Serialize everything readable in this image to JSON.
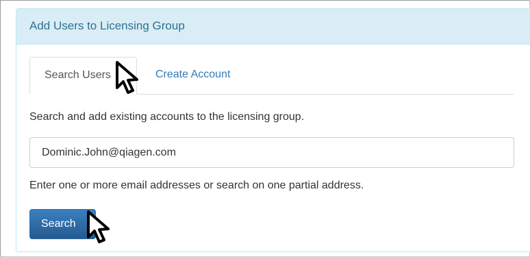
{
  "panel": {
    "title": "Add Users to Licensing Group"
  },
  "tabs": [
    {
      "label": "Search Users",
      "active": true
    },
    {
      "label": "Create Account",
      "active": false
    }
  ],
  "search_section": {
    "description": "Search and add existing accounts to the licensing group.",
    "input_value": "Dominic.John@qiagen.com",
    "hint": "Enter one or more email addresses or search on one partial address.",
    "button_label": "Search"
  },
  "icons": {
    "cursor": "mouse-pointer-icon"
  },
  "colors": {
    "panel_heading_bg": "#d9edf7",
    "panel_heading_text": "#31708f",
    "link": "#337ab7",
    "primary_button": "#2f6fac"
  }
}
